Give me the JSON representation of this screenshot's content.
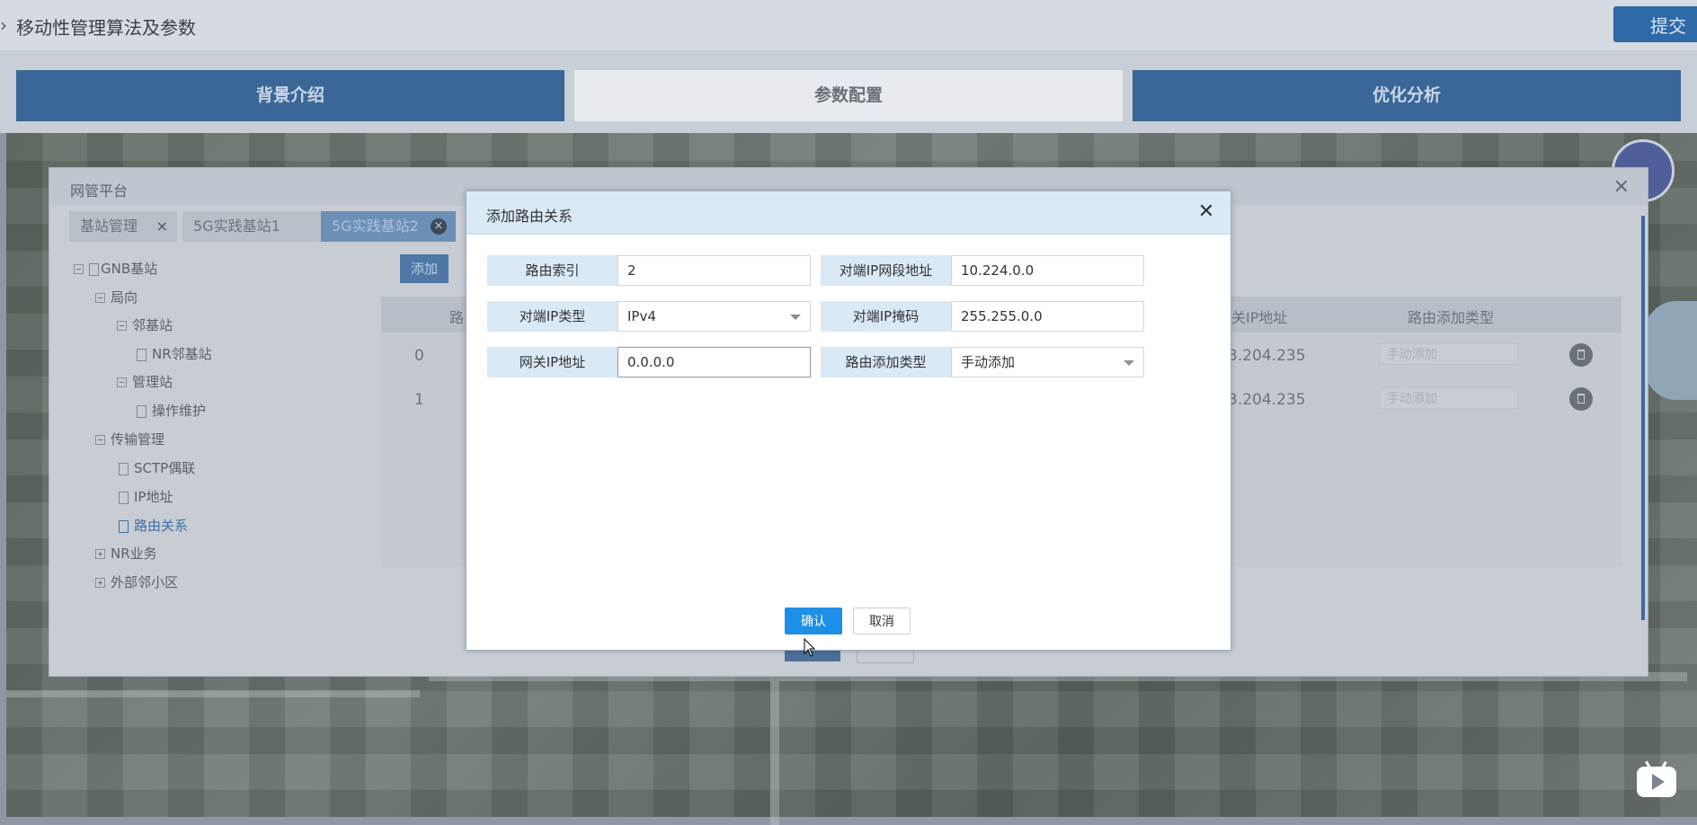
{
  "header": {
    "title": "移动性管理算法及参数",
    "submit_label": "提交"
  },
  "nav": {
    "tabs": [
      {
        "label": "背景介绍"
      },
      {
        "label": "参数配置"
      },
      {
        "label": "优化分析"
      }
    ]
  },
  "network_window": {
    "title": "网管平台",
    "tabs": [
      {
        "label": "基站管理"
      },
      {
        "label": "5G实践基站1"
      },
      {
        "label": "5G实践基站2"
      }
    ],
    "tree": [
      {
        "label": "GNB基站"
      },
      {
        "label": "局向"
      },
      {
        "label": "邻基站"
      },
      {
        "label": "NR邻基站"
      },
      {
        "label": "管理站"
      },
      {
        "label": "操作维护"
      },
      {
        "label": "传输管理"
      },
      {
        "label": "SCTP偶联"
      },
      {
        "label": "IP地址"
      },
      {
        "label": "路由关系"
      },
      {
        "label": "NR业务"
      },
      {
        "label": "外部邻小区"
      }
    ],
    "add_label": "添加",
    "table": {
      "headers": {
        "col1": "路",
        "col_gateway": "网关IP地址",
        "col_type": "路由添加类型"
      },
      "rows": [
        {
          "index": "0",
          "gateway": "3.204.235",
          "type": "手动添加"
        },
        {
          "index": "1",
          "gateway": "3.204.235",
          "type": "手动添加"
        }
      ]
    }
  },
  "modal": {
    "title": "添加路由关系",
    "fields": {
      "route_index": {
        "label": "路由索引",
        "value": "2"
      },
      "peer_segment": {
        "label": "对端IP网段地址",
        "value": "10.224.0.0"
      },
      "peer_ip_type": {
        "label": "对端IP类型",
        "value": "IPv4"
      },
      "peer_mask": {
        "label": "对端IP掩码",
        "value": "255.255.0.0"
      },
      "gateway_ip": {
        "label": "网关IP地址",
        "value": "0.0.0.0"
      },
      "route_add_type": {
        "label": "路由添加类型",
        "value": "手动添加"
      }
    },
    "confirm_label": "确认",
    "cancel_label": "取消"
  },
  "colors": {
    "primary": "#1e8fe6",
    "label_bg": "#d9e9f6",
    "nav_tab": "#3a6797"
  }
}
